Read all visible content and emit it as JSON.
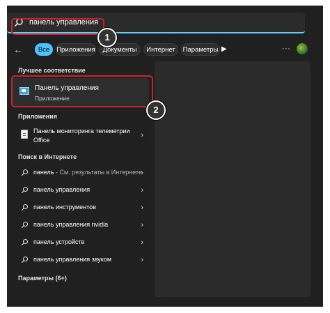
{
  "search": {
    "value": "панель управления"
  },
  "filters": {
    "back": "←",
    "chips": [
      "Все",
      "Приложения",
      "Документы",
      "Интернет",
      "Параметры"
    ],
    "play": "▶",
    "more": "···"
  },
  "best_match": {
    "heading": "Лучшее соответствие",
    "title": "Панель управления",
    "subtitle": "Приложение"
  },
  "apps": {
    "heading": "Приложения",
    "item_line1": "Панель мониторинга телеметрии",
    "item_line2": "Office"
  },
  "web": {
    "heading": "Поиск в Интернете",
    "first_query": "панель",
    "first_suffix": " - См. результаты в Интернете",
    "items": [
      "панель управления",
      "панель инструментов",
      "панель управления nvidia",
      "панель устройств",
      "панель управления звуком"
    ]
  },
  "settings": {
    "heading": "Параметры (6+)"
  },
  "chevron": "›",
  "annotations": {
    "step1": "1",
    "step2": "2",
    "color": "#c8232a"
  }
}
